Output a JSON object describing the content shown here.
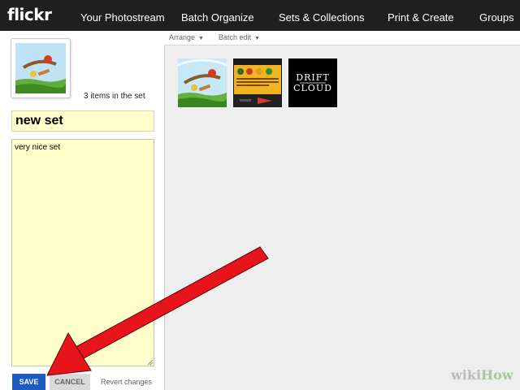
{
  "app": {
    "logo": "flickr"
  },
  "nav": {
    "items": [
      "Your Photostream",
      "Batch Organize",
      "Sets & Collections",
      "Print & Create",
      "Groups"
    ]
  },
  "set": {
    "items_count": "3 items in the set",
    "title_value": "new set",
    "description_value": "very nice set"
  },
  "actions": {
    "save_label": "SAVE",
    "cancel_label": "CANCEL",
    "revert_label": "Revert changes"
  },
  "toolbar": {
    "arrange_label": "Arrange",
    "batch_edit_label": "Batch edit"
  },
  "thumbnails": [
    {
      "name": "angry-birds-thumb",
      "description_text": ""
    },
    {
      "name": "game-screen-thumb",
      "description_text": ""
    },
    {
      "name": "drift-cloud-thumb",
      "text_line1": "DRIFT",
      "text_line2": "CLOUD"
    }
  ],
  "overlay": {
    "arrow_color": "#e8141b",
    "watermark_wiki": "wiki",
    "watermark_how": "How"
  },
  "colors": {
    "topbar": "#1f1f1f",
    "input_bg": "#ffffcc",
    "save_button": "#1a5bc4",
    "content_bg": "#eeeeee"
  }
}
